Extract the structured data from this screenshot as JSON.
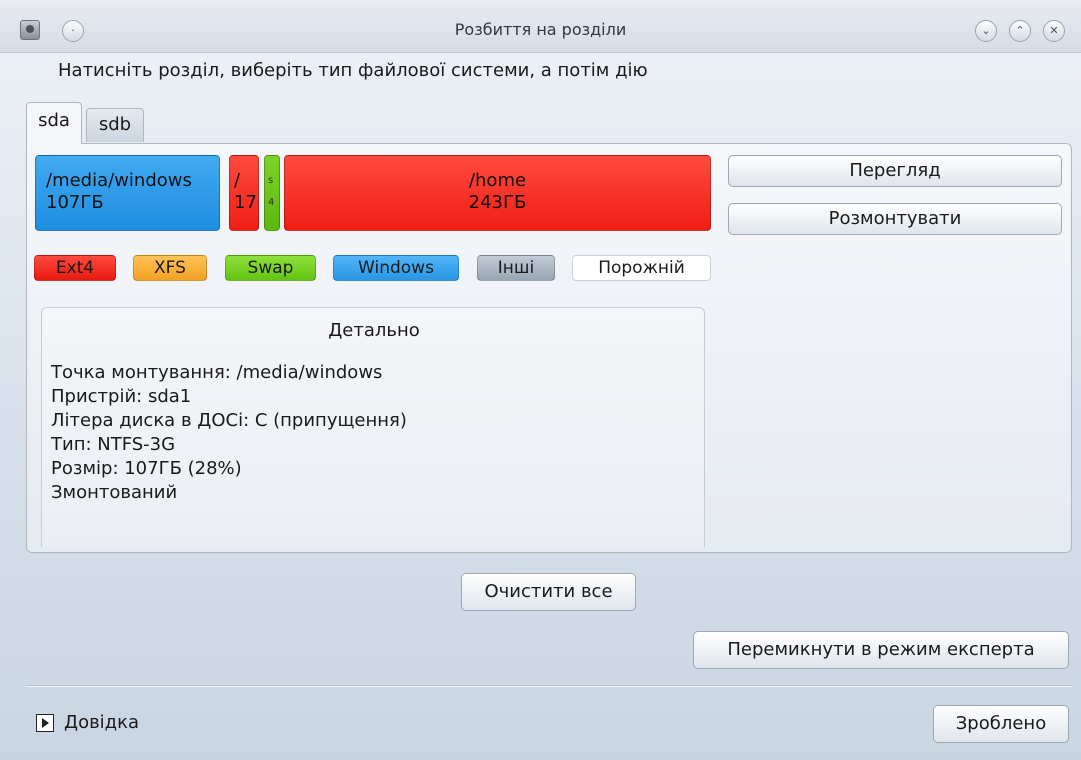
{
  "window": {
    "title": "Розбиття на розділи",
    "instruction": "Натисніть розділ, виберіть тип файлової системи, а потім дію"
  },
  "tabs": [
    {
      "label": "sda",
      "selected": true
    },
    {
      "label": "sdb",
      "selected": false
    }
  ],
  "partitions": [
    {
      "line1": "/media/windows",
      "line2": "107ГБ",
      "color": "#2b9bea"
    },
    {
      "line1": "/",
      "line2": "17",
      "color": "#f52a20"
    },
    {
      "line1": "s",
      "line2": "4",
      "color": "#6cc41c"
    },
    {
      "line1": "/home",
      "line2": "243ГБ",
      "color": "#f52a20"
    }
  ],
  "actions": {
    "view": "Перегляд",
    "unmount": "Розмонтувати"
  },
  "legend": {
    "ext4": "Ext4",
    "xfs": "XFS",
    "swap": "Swap",
    "windows": "Windows",
    "other": "Інші",
    "empty": "Порожній"
  },
  "details": {
    "title": "Детально",
    "lines": [
      "Точка монтування: /media/windows",
      "Пристрій: sda1",
      "Літера диска в ДОСі: C (припущення)",
      "Тип: NTFS-3G",
      "Розмір: 107ГБ (28%)",
      "Змонтований"
    ]
  },
  "buttons": {
    "clear_all": "Очистити все",
    "expert_mode": "Перемикнути в режим експерта",
    "done": "Зроблено"
  },
  "help": {
    "label": "Довідка"
  },
  "icons": {
    "app": "app-icon",
    "pin": "pin-icon",
    "minimize": "chevron-down-icon",
    "maximize": "chevron-up-icon",
    "close": "close-icon",
    "help_toggle": "triangle-right-icon"
  }
}
